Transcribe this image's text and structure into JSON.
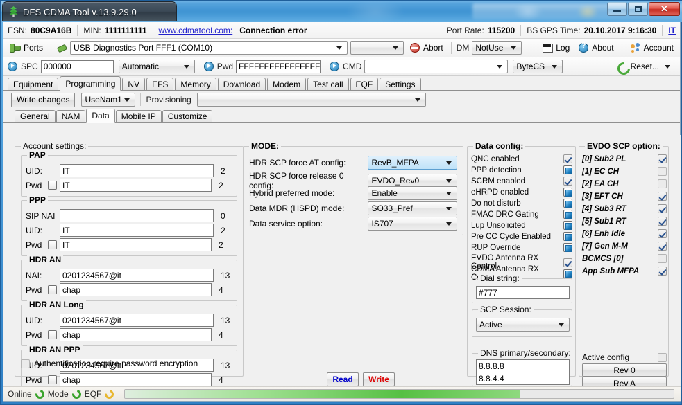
{
  "window": {
    "app_title": "DFS CDMA Tool v.13.9.29.0",
    "minimize": "minimize-button",
    "maximize": "maximize-button",
    "close": "✕"
  },
  "header": {
    "esn_label": "ESN:",
    "esn_value": "80C9A16B",
    "min_label": "MIN:",
    "min_value": "1111111111",
    "site_link": "www.cdmatool.com:",
    "connection_status": "Connection error",
    "port_rate_label": "Port Rate:",
    "port_rate_value": "115200",
    "gps_label": "BS GPS Time:",
    "gps_value": "20.10.2017 9:16:30",
    "lang": "IT"
  },
  "toolbar1": {
    "ports_label": "Ports",
    "port_combo_value": "USB Diagnostics Port FFF1 (COM10)",
    "secondary_combo_value": "",
    "abort_label": "Abort",
    "dm_label": "DM",
    "dm_combo_value": "NotUse",
    "log_label": "Log",
    "about_label": "About",
    "account_label": "Account"
  },
  "toolbar2": {
    "spc_label": "SPC",
    "spc_value": "000000",
    "spc_mode_value": "Automatic",
    "pwd_label": "Pwd",
    "pwd_value": "FFFFFFFFFFFFFFFF",
    "cmd_label": "CMD",
    "cmd_value": "",
    "bytecs_value": "ByteCS",
    "reset_label": "Reset..."
  },
  "main_tabs": [
    {
      "label": "Equipment",
      "active": false
    },
    {
      "label": "Programming",
      "active": true
    },
    {
      "label": "NV",
      "active": false
    },
    {
      "label": "EFS",
      "active": false
    },
    {
      "label": "Memory",
      "active": false
    },
    {
      "label": "Download",
      "active": false
    },
    {
      "label": "Modem",
      "active": false
    },
    {
      "label": "Test call",
      "active": false
    },
    {
      "label": "EQF",
      "active": false
    },
    {
      "label": "Settings",
      "active": false
    }
  ],
  "prog_toolbar": {
    "write_changes_label": "Write changes",
    "nam_combo_value": "UseNam1",
    "provisioning_label": "Provisioning",
    "provisioning_combo_value": ""
  },
  "sub_tabs": [
    {
      "label": "General",
      "active": false
    },
    {
      "label": "NAM",
      "active": false
    },
    {
      "label": "Data",
      "active": true
    },
    {
      "label": "Mobile IP",
      "active": false
    },
    {
      "label": "Customize",
      "active": false
    }
  ],
  "account_settings": {
    "caption": "Account settings:",
    "groups": [
      {
        "name": "PAP",
        "rows": [
          {
            "label": "UID:",
            "checkbox": false,
            "checked": false,
            "value": "IT",
            "count": "2"
          },
          {
            "label": "Pwd",
            "checkbox": true,
            "checked": false,
            "value": "IT",
            "count": "2"
          }
        ]
      },
      {
        "name": "PPP",
        "rows": [
          {
            "label": "SIP NAI",
            "checkbox": false,
            "checked": false,
            "value": "",
            "count": "0"
          },
          {
            "label": "UID:",
            "checkbox": false,
            "checked": false,
            "value": "IT",
            "count": "2"
          },
          {
            "label": "Pwd",
            "checkbox": true,
            "checked": false,
            "value": "IT",
            "count": "2"
          }
        ]
      },
      {
        "name": "HDR AN",
        "rows": [
          {
            "label": "NAI:",
            "checkbox": false,
            "checked": false,
            "value": "0201234567@it",
            "count": "13"
          },
          {
            "label": "Pwd",
            "checkbox": true,
            "checked": false,
            "value": "chap",
            "count": "4"
          }
        ]
      },
      {
        "name": "HDR AN Long",
        "rows": [
          {
            "label": "UID:",
            "checkbox": false,
            "checked": false,
            "value": "0201234567@it",
            "count": "13"
          },
          {
            "label": "Pwd",
            "checkbox": true,
            "checked": false,
            "value": "chap",
            "count": "4"
          }
        ]
      },
      {
        "name": "HDR AN PPP",
        "rows": [
          {
            "label": "UID:",
            "checkbox": false,
            "checked": false,
            "value": "0201234567@it",
            "count": "13"
          },
          {
            "label": "Pwd",
            "checkbox": true,
            "checked": false,
            "value": "chap",
            "count": "4"
          }
        ]
      }
    ],
    "encryption_label": "Authentification require password encryption",
    "encryption_checked": false
  },
  "mode": {
    "caption": "MODE:",
    "rows": [
      {
        "label": "HDR SCP force AT config:",
        "value": "RevB_MFPA",
        "highlight": true
      },
      {
        "label": "HDR SCP force release 0 config:",
        "value": "EVDO_Rev0",
        "highlight": false
      },
      {
        "label": "Hybrid preferred mode:",
        "value": "Enable",
        "highlight": false
      },
      {
        "label": "Data MDR (HSPD) mode:",
        "value": "SO33_Pref",
        "highlight": false
      },
      {
        "label": "Data service option:",
        "value": "IS707",
        "highlight": false
      }
    ]
  },
  "data_config": {
    "caption": "Data config:",
    "items": [
      {
        "label": "QNC enabled",
        "state": "checked"
      },
      {
        "label": "PPP detection",
        "state": "filled"
      },
      {
        "label": "SCRM enabled",
        "state": "checked"
      },
      {
        "label": "eHRPD enabled",
        "state": "filled"
      },
      {
        "label": "Do not disturb",
        "state": "filled"
      },
      {
        "label": "FMAC DRC Gating",
        "state": "filled"
      },
      {
        "label": "Lup Unsolicited",
        "state": "filled"
      },
      {
        "label": "Pre CC Cycle Enabled",
        "state": "filled"
      },
      {
        "label": "RUP Override",
        "state": "filled"
      },
      {
        "label": "EVDO Antenna RX Control",
        "state": "checked"
      },
      {
        "label": "CDMA Antenna RX Control",
        "state": "filled"
      }
    ],
    "dial_string_caption": "Dial string:",
    "dial_string_value": "#777",
    "scp_session_caption": "SCP Session:",
    "scp_session_value": "Active",
    "dns_caption": "DNS primary/secondary:",
    "dns_primary": "8.8.8.8",
    "dns_secondary": "8.8.4.4"
  },
  "evdo_scp": {
    "caption": "EVDO SCP option:",
    "items": [
      {
        "label": "[0] Sub2 PL",
        "state": "checked"
      },
      {
        "label": "[1] EC CH",
        "state": "unchecked"
      },
      {
        "label": "[2] EA CH",
        "state": "unchecked"
      },
      {
        "label": "[3] EFT CH",
        "state": "checked"
      },
      {
        "label": "[4] Sub3 RT",
        "state": "checked"
      },
      {
        "label": "[5] Sub1 RT",
        "state": "checked"
      },
      {
        "label": "[6] Enh Idle",
        "state": "checked"
      },
      {
        "label": "[7] Gen M-M",
        "state": "checked"
      },
      {
        "label": "BCMCS [0]",
        "state": "unchecked"
      },
      {
        "label": "App Sub MFPA",
        "state": "checked"
      }
    ],
    "active_config_label": "Active config",
    "active_config_checked": false,
    "rev0_label": "Rev 0",
    "reva_label": "Rev A"
  },
  "actions": {
    "read_label": "Read",
    "write_label": "Write"
  },
  "statusbar": {
    "online_label": "Online",
    "mode_label": "Mode",
    "eqf_label": "EQF",
    "progress_percent": 72
  },
  "colors": {
    "accent_blue": "#2f7fc4",
    "read_blue": "#0000cc",
    "write_red": "#dd0000",
    "link_blue": "#2222cc",
    "progress_green": "#56c043",
    "checkbox_blue": "#1c7ec0"
  }
}
